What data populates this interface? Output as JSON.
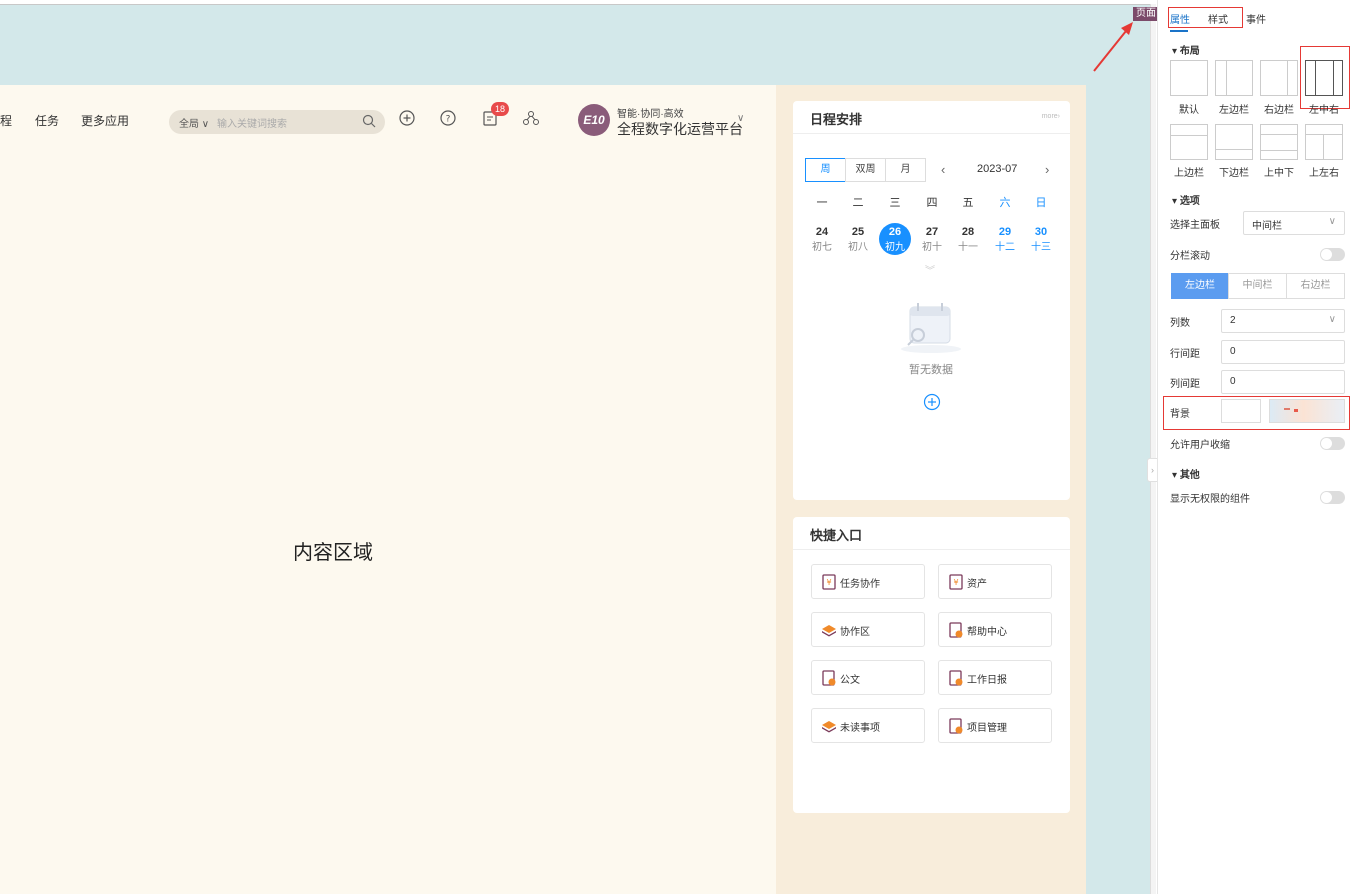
{
  "header": {
    "nav": [
      "程",
      "任务",
      "更多应用"
    ],
    "search": {
      "scope": "全局",
      "placeholder": "输入关键词搜索"
    },
    "badge_count": "18",
    "avatar_text": "E10",
    "org_line1": "智能·协同·高效",
    "org_line2": "全程数字化运营平台"
  },
  "main": {
    "content_label": "内容区域"
  },
  "schedule": {
    "title": "日程安排",
    "more": "more›",
    "views": [
      "周",
      "双周",
      "月"
    ],
    "month": "2023-07",
    "prev": "‹",
    "next": "›",
    "weekdays": [
      "一",
      "二",
      "三",
      "四",
      "五",
      "六",
      "日"
    ],
    "days": [
      {
        "d": "24",
        "l": "初七"
      },
      {
        "d": "25",
        "l": "初八"
      },
      {
        "d": "26",
        "l": "初九"
      },
      {
        "d": "27",
        "l": "初十"
      },
      {
        "d": "28",
        "l": "十一"
      },
      {
        "d": "29",
        "l": "十二"
      },
      {
        "d": "30",
        "l": "十三"
      }
    ],
    "empty_text": "暂无数据"
  },
  "quick": {
    "title": "快捷入口",
    "items": [
      "任务协作",
      "资产",
      "协作区",
      "帮助中心",
      "公文",
      "工作日报",
      "未读事项",
      "项目管理"
    ]
  },
  "panel": {
    "tabs": [
      "属性",
      "样式",
      "事件"
    ],
    "page_badge": "页面",
    "layout_section": "布局",
    "layouts": [
      "默认",
      "左边栏",
      "右边栏",
      "左中右",
      "上边栏",
      "下边栏",
      "上中下",
      "上左右"
    ],
    "options_section": "选项",
    "main_panel_label": "选择主面板",
    "main_panel_value": "中间栏",
    "split_scroll_label": "分栏滚动",
    "column_tabs": [
      "左边栏",
      "中间栏",
      "右边栏"
    ],
    "cols_label": "列数",
    "cols_value": "2",
    "row_gap_label": "行间距",
    "row_gap_value": "0",
    "col_gap_label": "列间距",
    "col_gap_value": "0",
    "bg_label": "背景",
    "collapse_label": "允许用户收缩",
    "other_section": "其他",
    "show_no_perm_label": "显示无权限的组件"
  },
  "colors": {
    "accent": "#1890ff",
    "red_annotation": "#e53935",
    "canvas_bg": "#d3e8ea",
    "main_bg": "#fdf9ef",
    "side_bg": "#f8eddb"
  }
}
